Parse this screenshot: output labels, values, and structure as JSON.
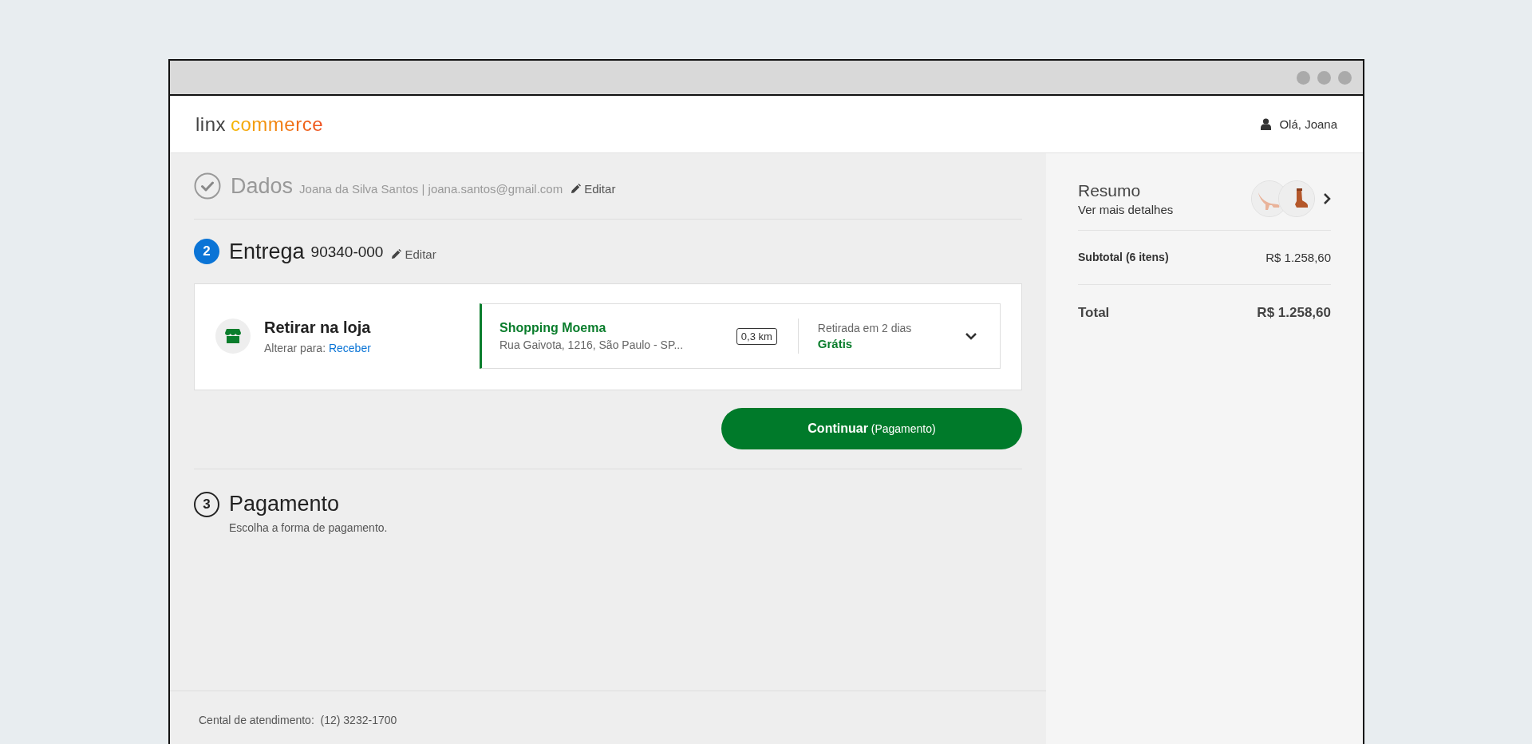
{
  "header": {
    "logo": [
      "linx",
      "commerce"
    ],
    "user": "Olá, Joana"
  },
  "steps": [
    {
      "kind": "done",
      "title": "Dados",
      "detail": "Joana da Silva Santos | joana.santos@gmail.com",
      "edit": "Editar"
    },
    {
      "kind": "current",
      "number": "2",
      "title": "Entrega",
      "detail": "90340-000",
      "edit": "Editar"
    },
    {
      "kind": "upcoming",
      "number": "3",
      "title": "Pagamento",
      "subtitle": "Escolha a forma de pagamento."
    }
  ],
  "delivery": {
    "title": "Retirar na loja",
    "switch_label": "Alterar para:",
    "switch_link": "Receber",
    "store": {
      "name": "Shopping Moema",
      "address": "Rua Gaivota, 1216, São Paulo - SP...",
      "distance": "0,3 km",
      "pickup": "Retirada em 2 dias",
      "price": "Grátis"
    }
  },
  "continue_button": "**Continuar** (Pagamento)",
  "footer": "Cental de atendimento:  (12) 3232-1700",
  "summary": {
    "title": "Resumo",
    "link": "Ver mais detalhes",
    "rows": [
      {
        "kind": "subtotal",
        "label": "Subtotal (6 itens)",
        "value": "R$ 1.258,60"
      },
      {
        "kind": "total",
        "label": "Total",
        "value": "R$ 1.258,60"
      }
    ]
  }
}
